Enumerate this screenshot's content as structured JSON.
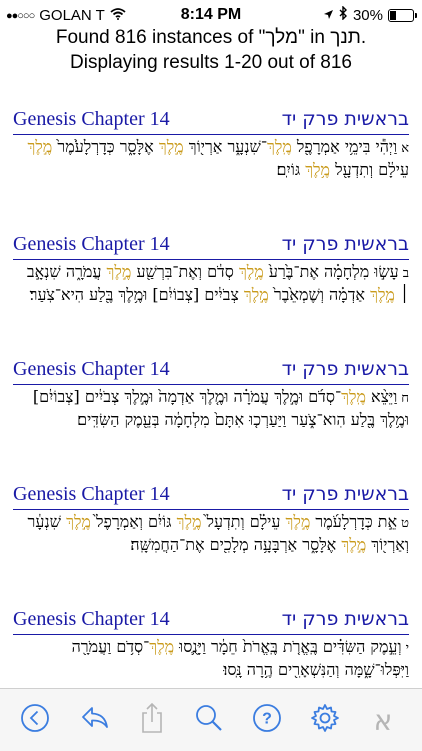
{
  "status": {
    "carrier": "GOLAN T",
    "time": "8:14 PM",
    "battery": "30%",
    "battery_level": 0.3,
    "signal_dots": "●●○○○"
  },
  "header": {
    "line1": "Found 816 instances of \"מלך\" in תנך.",
    "line2": "Displaying results 1-20 out of 816"
  },
  "colors": {
    "link": "#1a1aa6",
    "highlight": "#c99a1a",
    "toolbar_icon": "#3b7de0",
    "disabled_icon": "#b5b5b5"
  },
  "results": [
    {
      "eng": "Genesis Chapter 14",
      "heb": "בראשית פרק יד",
      "verse_num": "א",
      "segments": [
        {
          "t": "וַיְהִ֕י בִּימֵ֥י אַמְרָפֶ֖ל ",
          "h": false
        },
        {
          "t": "מֶֽלֶךְ",
          "h": true
        },
        {
          "t": "־שִׁנְעָ֑ר אַרְי֖וֹךְ ",
          "h": false
        },
        {
          "t": "מֶ֣לֶךְ",
          "h": true
        },
        {
          "t": " אֶלָּסָ֑ר כְּדָרְלָעֹ֙מֶר֙ ",
          "h": false
        },
        {
          "t": "מֶ֣לֶךְ",
          "h": true
        },
        {
          "t": " עֵילָ֔ם וְתִדְעָ֖ל ",
          "h": false
        },
        {
          "t": "מֶ֥לֶךְ",
          "h": true
        },
        {
          "t": " גּוֹיִֽם׃",
          "h": false
        }
      ]
    },
    {
      "eng": "Genesis Chapter 14",
      "heb": "בראשית פרק יד",
      "verse_num": "ב",
      "segments": [
        {
          "t": "עָשׂ֣וּ מִלְחָמָ֗ה אֶת־בֶּ֙רַע֙ ",
          "h": false
        },
        {
          "t": "מֶ֣לֶךְ",
          "h": true
        },
        {
          "t": " סְדֹ֔ם וְאֶת־בִּרְשַׁ֖ע ",
          "h": false
        },
        {
          "t": "מֶ֣לֶךְ",
          "h": true
        },
        {
          "t": " עֲמֹרָ֑ה שִׁנְאָ֣ב ׀ ",
          "h": false
        },
        {
          "t": "מֶ֣לֶךְ",
          "h": true
        },
        {
          "t": " אַדְמָ֗ה וְשֶׁמְאֵ֙בֶר֙ ",
          "h": false
        },
        {
          "t": "מֶ֣לֶךְ",
          "h": true
        },
        {
          "t": " צְבֹיִ֔ים [צְבוֹיִ֔ם] וּמֶ֥לֶךְ בֶּ֖לַע הִיא־צֹֽעַר׃",
          "h": false
        }
      ]
    },
    {
      "eng": "Genesis Chapter 14",
      "heb": "בראשית פרק יד",
      "verse_num": "ח",
      "segments": [
        {
          "t": "וַיֵּצֵ֨א ",
          "h": false
        },
        {
          "t": "מֶֽלֶךְ",
          "h": true
        },
        {
          "t": "־סְדֹ֜ם וּמֶ֣לֶךְ עֲמֹרָ֗ה וּמֶ֤לֶךְ אַדְמָה֙ וּמֶ֣לֶךְ צְבֹיִ֔ים [צְבוֹיִ֔ם] וּמֶ֥לֶךְ בֶּ֖לַע הִוא־צֹ֑עַר וַיַּעַרְכ֤וּ אִתָּם֙ מִלְחָמָ֔ה בְּעֵ֖מֶק הַשִּׂדִּֽים׃",
          "h": false
        }
      ]
    },
    {
      "eng": "Genesis Chapter 14",
      "heb": "בראשית פרק יד",
      "verse_num": "ט",
      "segments": [
        {
          "t": "אֵ֣ת כְּדָרְלָעֹ֜מֶר ",
          "h": false
        },
        {
          "t": "מֶ֣לֶךְ",
          "h": true
        },
        {
          "t": " עֵילָ֗ם וְתִדְעָל֙ ",
          "h": false
        },
        {
          "t": "מֶ֣לֶךְ",
          "h": true
        },
        {
          "t": " גּוֹיִ֔ם וְאַמְרָפֶל֙ ",
          "h": false
        },
        {
          "t": "מֶ֣לֶךְ",
          "h": true
        },
        {
          "t": " שִׁנְעָ֔ר וְאַרְי֖וֹךְ ",
          "h": false
        },
        {
          "t": "מֶ֣לֶךְ",
          "h": true
        },
        {
          "t": " אֶלָּסָ֑ר אַרְבָּעָ֥ה מְלָכִ֖ים אֶת־הַחֲמִשָּֽׁה׃",
          "h": false
        }
      ]
    },
    {
      "eng": "Genesis Chapter 14",
      "heb": "בראשית פרק יד",
      "verse_num": "י",
      "segments": [
        {
          "t": "וְעֵ֣מֶק הַשִּׂדִּ֗ים בֶּֽאֱרֹ֤ת בֶּֽאֱרֹת֙ חֵמָ֔ר וַיָּנֻ֛סוּ ",
          "h": false
        },
        {
          "t": "מֶֽלֶךְ",
          "h": true
        },
        {
          "t": "־סְדֹ֥ם וַעֲמֹרָ֖ה וַיִּפְּלוּ־שָׁ֑מָּה וְהַנִּשְׁאָרִ֖ים הֶ֥רָה נָּֽסוּ׃",
          "h": false
        }
      ]
    }
  ],
  "toolbar": {
    "items": [
      {
        "icon": "back-circle-icon"
      },
      {
        "icon": "reply-icon"
      },
      {
        "icon": "share-icon"
      },
      {
        "icon": "search-icon"
      },
      {
        "icon": "help-icon"
      },
      {
        "icon": "settings-icon"
      },
      {
        "icon": "hebrew-alef-icon",
        "label": "א"
      }
    ]
  }
}
